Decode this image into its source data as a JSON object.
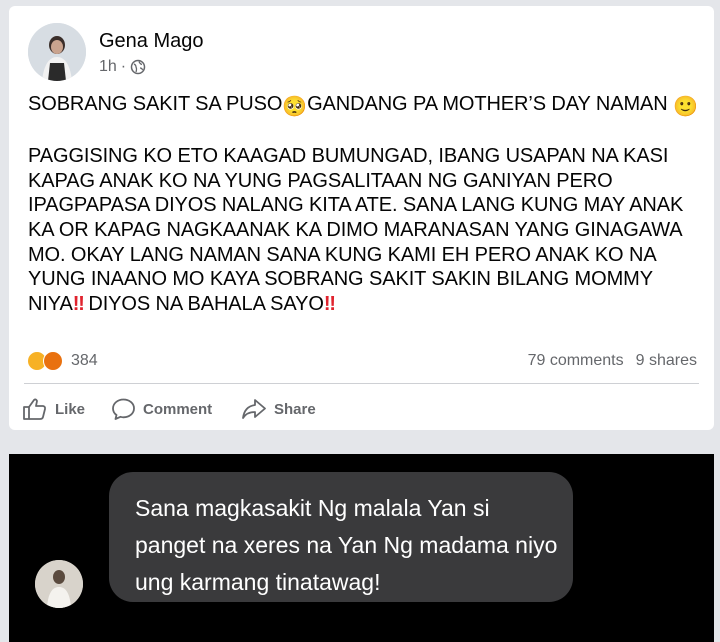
{
  "post": {
    "author": "Gena Mago",
    "time": "1h",
    "dot": "·",
    "privacy_icon": "globe-icon",
    "line1": "SOBRANG SAKIT SA PUSO",
    "line1b": "GANDANG PA MOTHER’S DAY NAMAN",
    "emoji_pleading": "🥺",
    "emoji_smile": "🙂",
    "body": "PAGGISING KO ETO KAAGAD BUMUNGAD, IBANG USAPAN NA KASI KAPAG ANAK KO NA YUNG PAGSALITAAN NG GANIYAN PERO IPAGPAPASA DIYOS NALANG KITA ATE. SANA LANG KUNG MAY ANAK KA OR KAPAG NAGKAANAK KA DIMO MARANASAN YANG GINAGAWA MO. OKAY LANG NAMAN SANA KUNG KAMI EH PERO ANAK KO NA YUNG INAANO MO KAYA SOBRANG SAKIT SAKIN BILANG MOMMY NIYA",
    "bang": "‼",
    "tail": " DIYOS NA BAHALA SAYO",
    "reaction_count": "384",
    "comments": "79 comments",
    "shares": "9 shares",
    "actions": {
      "like": "Like",
      "comment": "Comment",
      "share": "Share"
    }
  },
  "comment": {
    "text": "Sana magkasakit Ng malala Yan si panget na xeres na Yan Ng madama niyo ung karmang tinatawag!"
  },
  "colors": {
    "background": "#e4e6ea",
    "card": "#ffffff",
    "secondary_text": "#65676b",
    "bubble": "#3a3a3c",
    "dark_panel": "#000000",
    "bang": "#e0232e"
  }
}
